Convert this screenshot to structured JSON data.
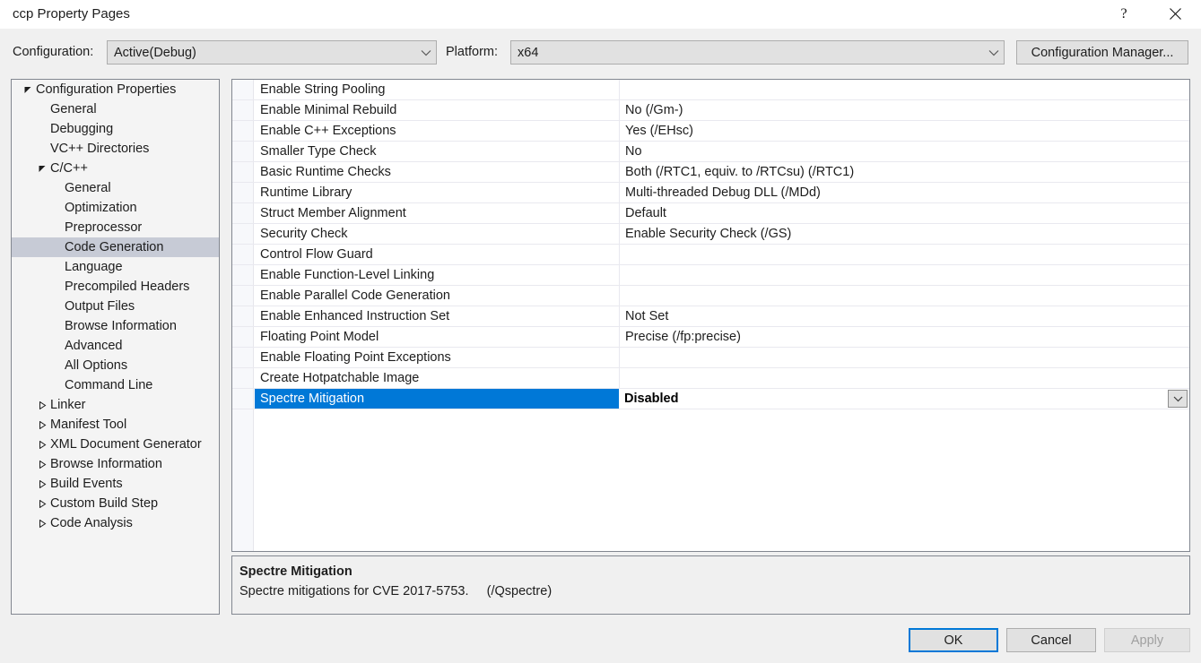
{
  "window": {
    "title": "ccp Property Pages",
    "help_icon": "question-mark-icon",
    "close_icon": "close-icon"
  },
  "toolbar": {
    "configuration_label": "Configuration:",
    "configuration_value": "Active(Debug)",
    "platform_label": "Platform:",
    "platform_value": "x64",
    "configuration_manager_label": "Configuration Manager..."
  },
  "tree": {
    "items": [
      {
        "label": "Configuration Properties",
        "indent": 0,
        "arrow": "expanded",
        "selected": false
      },
      {
        "label": "General",
        "indent": 1,
        "arrow": "none",
        "selected": false
      },
      {
        "label": "Debugging",
        "indent": 1,
        "arrow": "none",
        "selected": false
      },
      {
        "label": "VC++ Directories",
        "indent": 1,
        "arrow": "none",
        "selected": false
      },
      {
        "label": "C/C++",
        "indent": 1,
        "arrow": "expanded",
        "selected": false
      },
      {
        "label": "General",
        "indent": 2,
        "arrow": "none",
        "selected": false
      },
      {
        "label": "Optimization",
        "indent": 2,
        "arrow": "none",
        "selected": false
      },
      {
        "label": "Preprocessor",
        "indent": 2,
        "arrow": "none",
        "selected": false
      },
      {
        "label": "Code Generation",
        "indent": 2,
        "arrow": "none",
        "selected": true
      },
      {
        "label": "Language",
        "indent": 2,
        "arrow": "none",
        "selected": false
      },
      {
        "label": "Precompiled Headers",
        "indent": 2,
        "arrow": "none",
        "selected": false
      },
      {
        "label": "Output Files",
        "indent": 2,
        "arrow": "none",
        "selected": false
      },
      {
        "label": "Browse Information",
        "indent": 2,
        "arrow": "none",
        "selected": false
      },
      {
        "label": "Advanced",
        "indent": 2,
        "arrow": "none",
        "selected": false
      },
      {
        "label": "All Options",
        "indent": 2,
        "arrow": "none",
        "selected": false
      },
      {
        "label": "Command Line",
        "indent": 2,
        "arrow": "none",
        "selected": false
      },
      {
        "label": "Linker",
        "indent": 1,
        "arrow": "collapsed",
        "selected": false
      },
      {
        "label": "Manifest Tool",
        "indent": 1,
        "arrow": "collapsed",
        "selected": false
      },
      {
        "label": "XML Document Generator",
        "indent": 1,
        "arrow": "collapsed",
        "selected": false
      },
      {
        "label": "Browse Information",
        "indent": 1,
        "arrow": "collapsed",
        "selected": false
      },
      {
        "label": "Build Events",
        "indent": 1,
        "arrow": "collapsed",
        "selected": false
      },
      {
        "label": "Custom Build Step",
        "indent": 1,
        "arrow": "collapsed",
        "selected": false
      },
      {
        "label": "Code Analysis",
        "indent": 1,
        "arrow": "collapsed",
        "selected": false
      }
    ]
  },
  "grid": {
    "rows": [
      {
        "name": "Enable String Pooling",
        "value": "",
        "selected": false,
        "dropdown": false
      },
      {
        "name": "Enable Minimal Rebuild",
        "value": "No (/Gm-)",
        "selected": false,
        "dropdown": false
      },
      {
        "name": "Enable C++ Exceptions",
        "value": "Yes (/EHsc)",
        "selected": false,
        "dropdown": false
      },
      {
        "name": "Smaller Type Check",
        "value": "No",
        "selected": false,
        "dropdown": false
      },
      {
        "name": "Basic Runtime Checks",
        "value": "Both (/RTC1, equiv. to /RTCsu) (/RTC1)",
        "selected": false,
        "dropdown": false
      },
      {
        "name": "Runtime Library",
        "value": "Multi-threaded Debug DLL (/MDd)",
        "selected": false,
        "dropdown": false
      },
      {
        "name": "Struct Member Alignment",
        "value": "Default",
        "selected": false,
        "dropdown": false
      },
      {
        "name": "Security Check",
        "value": "Enable Security Check (/GS)",
        "selected": false,
        "dropdown": false
      },
      {
        "name": "Control Flow Guard",
        "value": "",
        "selected": false,
        "dropdown": false
      },
      {
        "name": "Enable Function-Level Linking",
        "value": "",
        "selected": false,
        "dropdown": false
      },
      {
        "name": "Enable Parallel Code Generation",
        "value": "",
        "selected": false,
        "dropdown": false
      },
      {
        "name": "Enable Enhanced Instruction Set",
        "value": "Not Set",
        "selected": false,
        "dropdown": false
      },
      {
        "name": "Floating Point Model",
        "value": "Precise (/fp:precise)",
        "selected": false,
        "dropdown": false
      },
      {
        "name": "Enable Floating Point Exceptions",
        "value": "",
        "selected": false,
        "dropdown": false
      },
      {
        "name": "Create Hotpatchable Image",
        "value": "",
        "selected": false,
        "dropdown": false
      },
      {
        "name": "Spectre Mitigation",
        "value": "Disabled",
        "selected": true,
        "dropdown": true
      }
    ]
  },
  "description": {
    "title": "Spectre Mitigation",
    "body": "Spectre mitigations for CVE 2017-5753.     (/Qspectre)"
  },
  "footer": {
    "ok_label": "OK",
    "cancel_label": "Cancel",
    "apply_label": "Apply"
  },
  "colors": {
    "selection_blue": "#0078d7",
    "tree_selection": "#c7cbd6",
    "dialog_bg": "#f0f0f0"
  }
}
